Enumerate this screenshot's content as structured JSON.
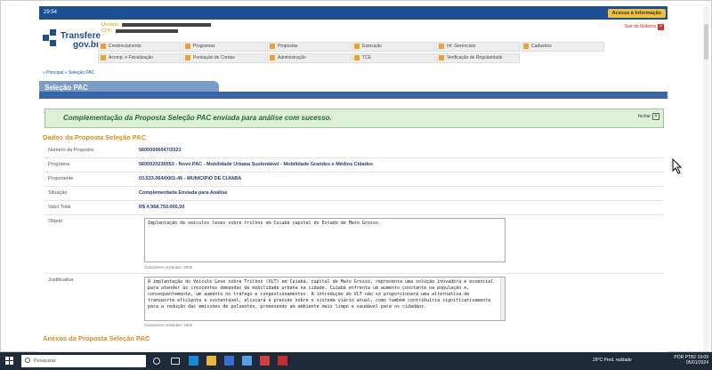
{
  "topbar": {
    "time": "29:54",
    "acesso": "Acesso à Informação"
  },
  "logo": {
    "line1": "Transfere",
    "line2": "gov.br"
  },
  "user": {
    "usuario_label": "Usuário:",
    "cpf_label": "CPF:"
  },
  "sair": {
    "label": "Sair do Sistema"
  },
  "menu": {
    "row1": [
      "Credenciamento",
      "Programas",
      "Propostas",
      "Execução",
      "Inf. Gerenciais",
      "Cadastros"
    ],
    "row2": [
      "Acomp. e Fiscalização",
      "Prestação de Contas",
      "Administração",
      "TCE",
      "Verificação de Regularidade"
    ]
  },
  "breadcrumb": "» Principal » Seleção PAC",
  "section_title": "Seleção PAC",
  "success": {
    "message": "Complementação da Proposta Seleção PAC enviada para análise com sucesso.",
    "close_label": "fechar",
    "close_icon": "close-icon"
  },
  "dados": {
    "heading": "Dados da Proposta Seleção PAC",
    "numero_label": "Número da Proposta",
    "numero": "56000006047/2023",
    "programa_label": "Programa",
    "programa": "5600020230053 - Novo PAC - Mobilidade Urbana Sustentável - Mobilidade Grandes e Médios Cidades",
    "proponente_label": "Proponente",
    "proponente": "03.533.064/0001-46 - MUNICIPIO DE CUIABA",
    "situacao_label": "Situação",
    "situacao": "Complementada Enviada para Análise",
    "valor_label": "Valor Total",
    "valor": "R$ 4.968.750.000,00",
    "objeto_label": "Objeto",
    "objeto": "Implantação de veículos leves sobre trilhos em Cuiabá capital do Estado de Mato Grosso.",
    "objeto_restantes": "Caracteres restantes: 5000",
    "justificativa_label": "Justificativa",
    "justificativa": "A implantação do Veículo Leve sobre Trilhos (VLT) em Cuiabá, capital de Mato Grosso, representa uma solução inovadora e essencial para atender às crescentes demandas de mobilidade urbana na cidade. Cuiabá enfrenta um aumento constante na população e, consequentemente, um aumento no tráfego e congestionamentos. A introdução do VLT não só proporcionará uma alternativa de transporte eficiente e sustentável, aliviará a pressão sobre o sistema viário atual, como também contribuiria significativamente para a redução das emissões de poluentes, promovendo um ambiente mais limpo e saudável para os cidadãos.",
    "justificativa_restantes": "Caracteres restantes: 5000"
  },
  "anexos": {
    "heading": "Anexos da Proposta Seleção PAC"
  },
  "taskbar": {
    "search_placeholder": "Pesquisar",
    "weather": "29°C  Pred. nublado",
    "lang": "POR PTB2",
    "time": "19:09",
    "date": "05/01/2024"
  }
}
